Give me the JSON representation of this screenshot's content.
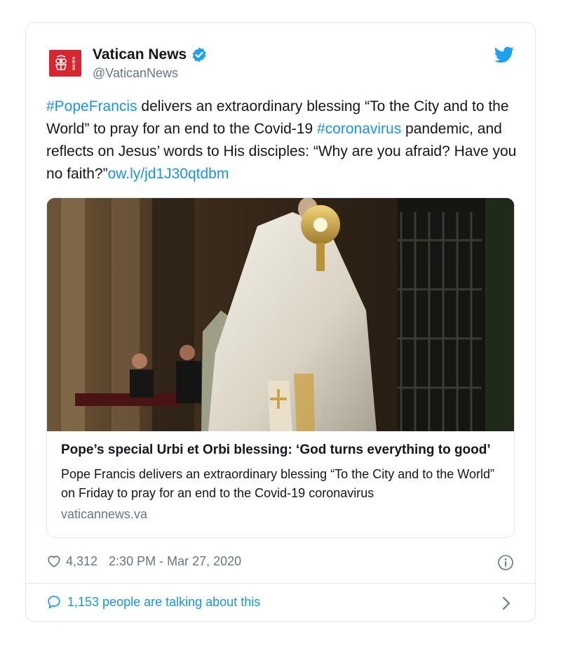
{
  "author": {
    "display_name": "Vatican News",
    "handle": "@VaticanNews",
    "logo_text": "NEWS"
  },
  "tweet": {
    "hashtag_1": "#PopeFrancis",
    "text_1": " delivers an extraordinary blessing “To the City and to the World” to pray for an end to the Covid-19 ",
    "hashtag_2": "#coronavirus",
    "text_2": " pandemic, and reflects on Jesus’ words to His disciples: “Why are you afraid? Have you no faith?”",
    "link": "ow.ly/jd1J30qtdbm"
  },
  "link_card": {
    "title": "Pope’s special Urbi et Orbi blessing: ‘God turns everything to good’",
    "description": "Pope Francis delivers an extraordinary blessing “To the City and to the World” on Friday to pray for an end to the Covid-19 coronavirus",
    "domain": "vaticannews.va"
  },
  "meta": {
    "likes": "4,312",
    "timestamp": "2:30 PM - Mar 27, 2020"
  },
  "footer": {
    "talking": "1,153 people are talking about this"
  },
  "colors": {
    "link_blue": "#1b95e0",
    "brand_red": "#d8252f",
    "muted_gray": "#657786"
  },
  "icons": {
    "verified": "verified-badge-icon",
    "bird": "twitter-bird-icon",
    "heart": "heart-icon",
    "info": "info-icon",
    "bubble": "speech-bubble-icon",
    "chevron": "chevron-right-icon"
  }
}
